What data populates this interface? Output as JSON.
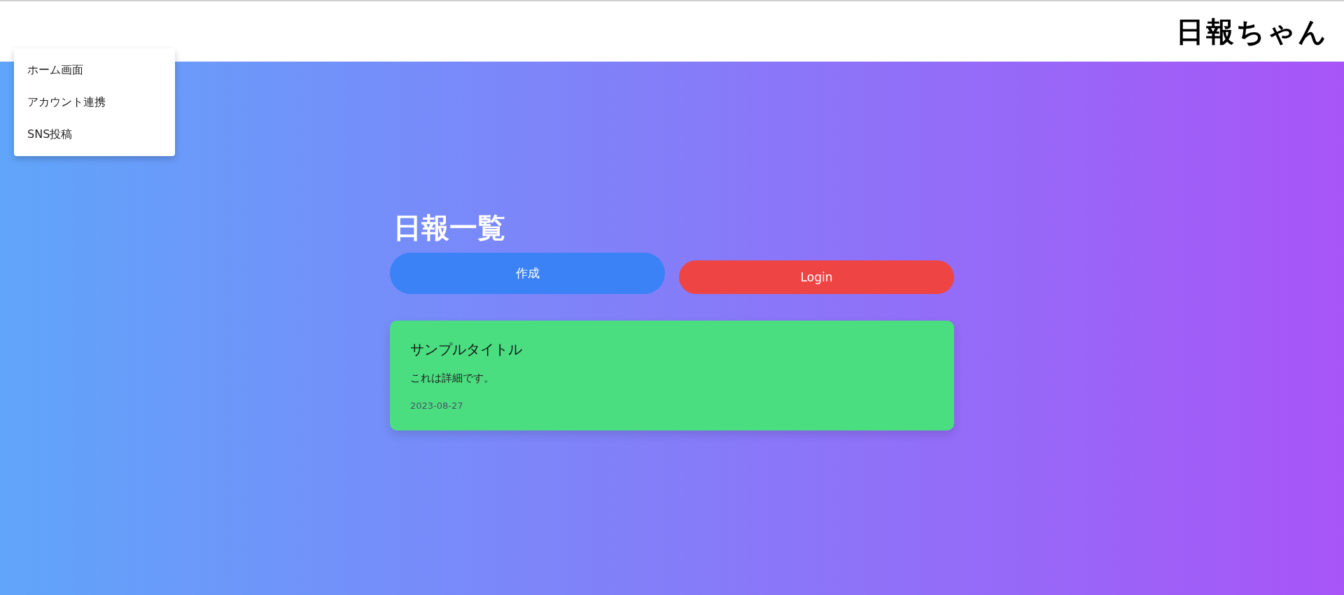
{
  "header": {
    "logo": "日報ちゃん"
  },
  "menu": {
    "items": [
      {
        "label": "ホーム画面"
      },
      {
        "label": "アカウント連携"
      },
      {
        "label": "SNS投稿"
      }
    ]
  },
  "page_title": "日報一覧",
  "buttons": [
    {
      "label": "作成",
      "kind": "create"
    },
    {
      "label": "Login",
      "kind": "login"
    }
  ],
  "reports": [
    {
      "title": "サンプルタイトル",
      "detail": "これは詳細です。",
      "date": "2023-08-27"
    }
  ]
}
